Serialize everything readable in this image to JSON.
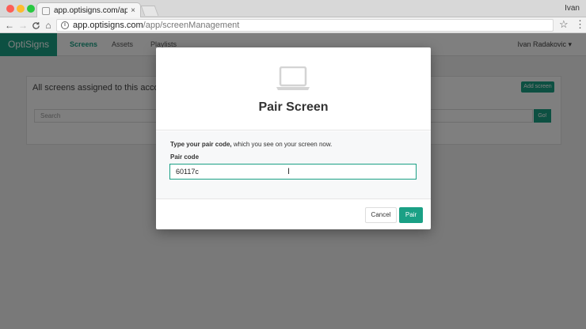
{
  "browser": {
    "tab_title": "app.optisigns.com/app/screenManagement",
    "tab_close_icon": "×",
    "profile_name": "Ivan",
    "url_host": "app.optisigns.com",
    "url_path": "/app/screenManagement",
    "back_icon": "←",
    "forward_icon": "→",
    "reload_icon": "C",
    "home_icon": "⌂",
    "info_icon": "i",
    "star_icon": "☆",
    "menu_icon": "⋮"
  },
  "app": {
    "brand": "OptiSigns",
    "nav": {
      "screens": "Screens",
      "assets": "Assets",
      "playlists": "Playlists"
    },
    "user_menu": "Ivan Radakovic ▾",
    "card_title": "All screens assigned to this account",
    "add_screen_label": "Add screen",
    "search_placeholder": "Search",
    "go_label": "Go!"
  },
  "modal": {
    "title": "Pair Screen",
    "instruction_bold": "Type your pair code,",
    "instruction_rest": " which you see on your screen now.",
    "field_label": "Pair code",
    "pair_code_value": "60117c",
    "text_cursor": "I",
    "cancel_label": "Cancel",
    "pair_label": "Pair"
  },
  "colors": {
    "accent": "#1aa085",
    "overlay": "rgba(0,0,0,0.5)"
  }
}
